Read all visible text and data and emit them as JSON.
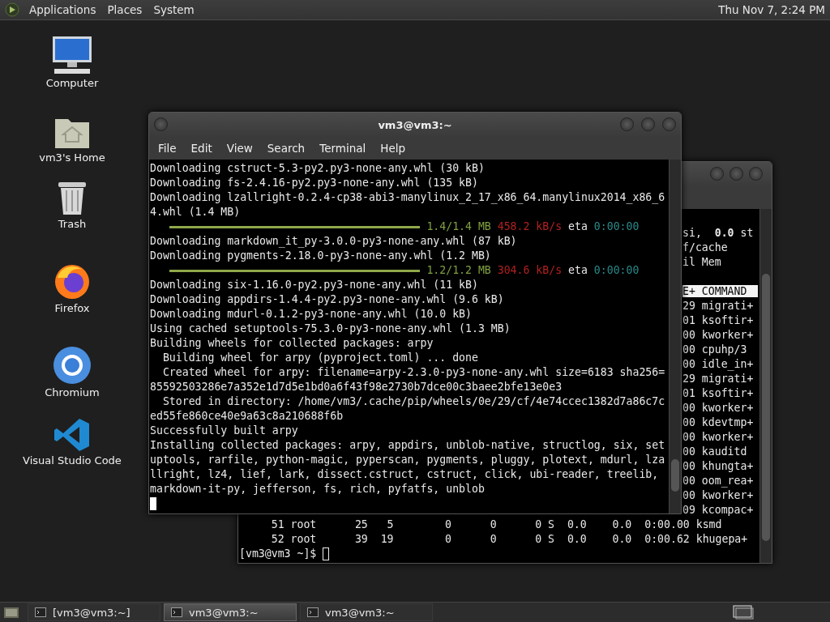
{
  "top_panel": {
    "menus": [
      "Applications",
      "Places",
      "System"
    ],
    "clock": "Thu Nov 7, 2:24 PM"
  },
  "desktop_icons": [
    {
      "kind": "computer",
      "label": "Computer"
    },
    {
      "kind": "home",
      "label": "vm3's Home"
    },
    {
      "kind": "trash",
      "label": "Trash"
    },
    {
      "kind": "firefox",
      "label": "Firefox"
    },
    {
      "kind": "chromium",
      "label": "Chromium"
    },
    {
      "kind": "vscode",
      "label": "Visual Studio Code"
    }
  ],
  "back_terminal": {
    "right_lines": [
      {
        "kind": "text",
        "text": "si,  **0.0** st"
      },
      {
        "kind": "text",
        "text": "f/cache"
      },
      {
        "kind": "text",
        "text": "il Mem"
      },
      {
        "kind": "blank"
      },
      {
        "kind": "header",
        "text": "E+ COMMAND"
      },
      {
        "kind": "text",
        "text": "29 migrati+"
      },
      {
        "kind": "text",
        "text": "01 ksoftir+"
      },
      {
        "kind": "text",
        "text": "00 kworker+"
      },
      {
        "kind": "text",
        "text": "00 cpuhp/3"
      },
      {
        "kind": "text",
        "text": "00 idle_in+"
      },
      {
        "kind": "text",
        "text": "29 migrati+"
      },
      {
        "kind": "text",
        "text": "01 ksoftir+"
      },
      {
        "kind": "text",
        "text": "00 kworker+"
      },
      {
        "kind": "text",
        "text": "00 kdevtmp+"
      },
      {
        "kind": "text",
        "text": "00 kworker+"
      },
      {
        "kind": "text",
        "text": "00 kauditd"
      },
      {
        "kind": "text",
        "text": "00 khungta+"
      },
      {
        "kind": "text",
        "text": "00 oom_rea+"
      },
      {
        "kind": "text",
        "text": "00 kworker+"
      },
      {
        "kind": "text",
        "text": "09 kcompac+"
      }
    ],
    "lines": [
      "     51 root      25   5        0      0      0 S  0.0    0.0  0:00.00 ksmd",
      "     52 root      39  19        0      0      0 S  0.0    0.0  0:00.62 khugepa+"
    ],
    "prompt": "[vm3@vm3 ~]$ "
  },
  "front_terminal": {
    "title": "vm3@vm3:~",
    "menus": [
      "File",
      "Edit",
      "View",
      "Search",
      "Terminal",
      "Help"
    ],
    "lines": [
      {
        "kind": "text",
        "text": "Downloading cstruct-5.3-py2.py3-none-any.whl (30 kB)"
      },
      {
        "kind": "text",
        "text": "Downloading fs-2.4.16-py2.py3-none-any.whl (135 kB)"
      },
      {
        "kind": "text",
        "text": "Downloading lzallright-0.2.4-cp38-abi3-manylinux_2_17_x86_64.manylinux2014_x86_6"
      },
      {
        "kind": "text",
        "text": "4.whl (1.4 MB)"
      },
      {
        "kind": "progress",
        "level": 1,
        "amount": "1.4/1.4 MB",
        "speed": "458.2 kB/s",
        "eta_label": "eta",
        "eta": "0:00:00"
      },
      {
        "kind": "text",
        "text": "Downloading markdown_it_py-3.0.0-py3-none-any.whl (87 kB)"
      },
      {
        "kind": "text",
        "text": "Downloading pygments-2.18.0-py3-none-any.whl (1.2 MB)"
      },
      {
        "kind": "progress",
        "level": 1,
        "amount": "1.2/1.2 MB",
        "speed": "304.6 kB/s",
        "eta_label": "eta",
        "eta": "0:00:00"
      },
      {
        "kind": "text",
        "text": "Downloading six-1.16.0-py2.py3-none-any.whl (11 kB)"
      },
      {
        "kind": "text",
        "text": "Downloading appdirs-1.4.4-py2.py3-none-any.whl (9.6 kB)"
      },
      {
        "kind": "text",
        "text": "Downloading mdurl-0.1.2-py3-none-any.whl (10.0 kB)"
      },
      {
        "kind": "text",
        "text": "Using cached setuptools-75.3.0-py3-none-any.whl (1.3 MB)"
      },
      {
        "kind": "text",
        "text": "Building wheels for collected packages: arpy"
      },
      {
        "kind": "text",
        "text": "  Building wheel for arpy (pyproject.toml) ... done"
      },
      {
        "kind": "text",
        "text": "  Created wheel for arpy: filename=arpy-2.3.0-py3-none-any.whl size=6183 sha256="
      },
      {
        "kind": "text",
        "text": "85592503286e7a352e1d7d5e1bd0a6f43f98e2730b7dce00c3baee2bfe13e0e3"
      },
      {
        "kind": "text",
        "text": "  Stored in directory: /home/vm3/.cache/pip/wheels/0e/29/cf/4e74ccec1382d7a86c7c"
      },
      {
        "kind": "text",
        "text": "ed55fe860ce40e9a63c8a210688f6b"
      },
      {
        "kind": "text",
        "text": "Successfully built arpy"
      },
      {
        "kind": "text",
        "text": "Installing collected packages: arpy, appdirs, unblob-native, structlog, six, set"
      },
      {
        "kind": "text",
        "text": "uptools, rarfile, python-magic, pyperscan, pygments, pluggy, plotext, mdurl, lza"
      },
      {
        "kind": "text",
        "text": "llright, lz4, lief, lark, dissect.cstruct, cstruct, click, ubi-reader, treelib,"
      },
      {
        "kind": "text",
        "text": "markdown-it-py, jefferson, fs, rich, pyfatfs, unblob"
      }
    ]
  },
  "taskbar": [
    {
      "label": "[vm3@vm3:~]",
      "selected": false
    },
    {
      "label": "vm3@vm3:~",
      "selected": true
    },
    {
      "label": "vm3@vm3:~",
      "selected": false
    }
  ]
}
